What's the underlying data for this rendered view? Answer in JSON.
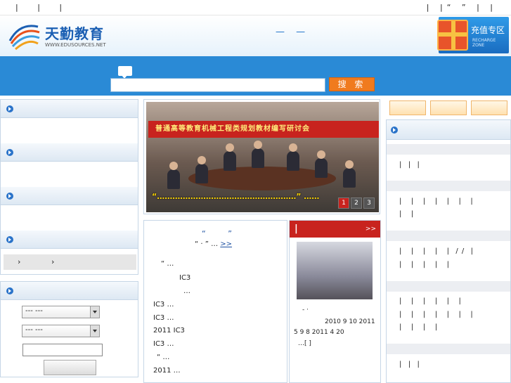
{
  "topbar": {
    "left_links": "| | |",
    "right_links": "| |“ ” | |"
  },
  "header": {
    "logo_text": "天勤教育",
    "logo_url": "WWW.EDUSOURCES.NET",
    "headline": "— —",
    "recharge_label": "充值专区",
    "recharge_sub": "RECHARGE ZONE"
  },
  "search": {
    "button_label": "搜 索",
    "value": ""
  },
  "left": {
    "crumb_sep": "›",
    "crumb_sep2": "›",
    "select1": "--- ---",
    "select2": "--- ---"
  },
  "slider": {
    "banner_text": "普通高等教育机械工程类规划教材编写研讨会",
    "caption": "“………………………………………………” ……",
    "pages": [
      "1",
      "2",
      "3"
    ]
  },
  "news": {
    "title": "“ ”",
    "lines": [
      {
        "text": "“ ·    ” …",
        "more": ">>"
      },
      {
        "text": "“      …"
      },
      {
        "text": "IC3"
      },
      {
        "text": "…"
      },
      {
        "text": "IC3             …"
      },
      {
        "text": "IC3             …"
      },
      {
        "text": "2011 IC3"
      },
      {
        "text": "IC3             …"
      },
      {
        "text": "“            …"
      },
      {
        "text": "2011             …"
      }
    ]
  },
  "side": {
    "bar": "|",
    "more": ">>",
    "lines": [
      "-            ·",
      "2010 9 10  2011",
      "5 9      8  2011 4 20",
      "…[ ]"
    ]
  },
  "right": {
    "lines": [
      "|  |  |",
      "|   |   |   |   |   |   |",
      "|   |",
      "|   |   |   |   |  / /  |",
      "|   |   |   |   |",
      "|   |   |   |   |   |",
      "|   |   |   |   |   |   |",
      "|   |   |   |",
      "|  |  |"
    ]
  }
}
